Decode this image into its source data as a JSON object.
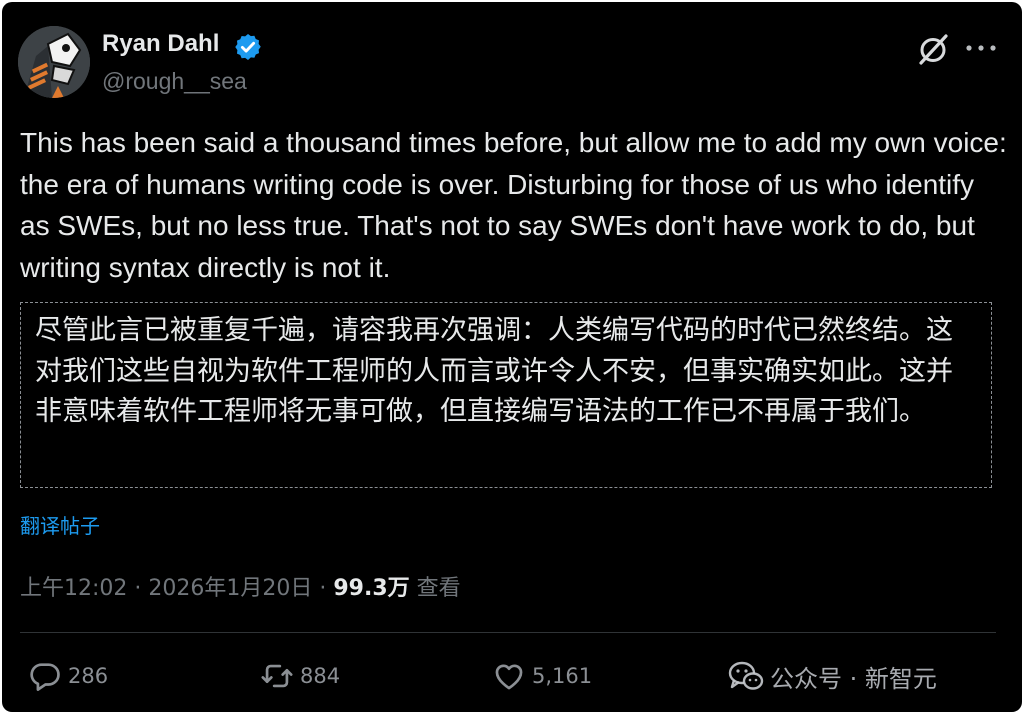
{
  "author": {
    "name": "Ryan Dahl",
    "handle": "@rough__sea",
    "verified_color": "#1d9bf0"
  },
  "header_icons": {
    "grok": "grok-icon",
    "more": "more-icon"
  },
  "tweet": {
    "text": "This has been said a thousand times before, but allow me to add my own voice: the era of humans writing code is over. Disturbing for those of us who identify as SWEs, but no less true. That's not to say SWEs don't have work to do, but writing syntax directly is not it.",
    "translation": "尽管此言已被重复千遍，请容我再次强调：人类编写代码的时代已然终结。这对我们这些自视为软件工程师的人而言或许令人不安，但事实确实如此。这并非意味着软件工程师将无事可做，但直接编写语法的工作已不再属于我们。",
    "translate_label": "翻译帖子",
    "time": "上午12:02",
    "date": "2026年1月20日",
    "separator": " · ",
    "views": "99.3万",
    "views_label": "查看"
  },
  "actions": {
    "replies": "286",
    "reposts": "884",
    "likes": "5,161"
  },
  "watermark": {
    "text": "公众号 · 新智元"
  },
  "colors": {
    "background": "#000000",
    "text": "#e7e9ea",
    "secondary": "#71767b",
    "link": "#1d9bf0"
  }
}
